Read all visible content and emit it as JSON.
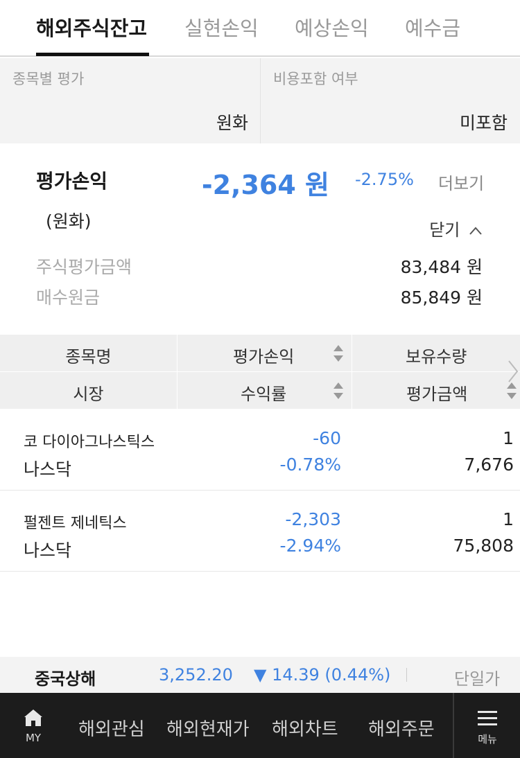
{
  "tabs": [
    {
      "label": "해외주식잔고",
      "active": true
    },
    {
      "label": "실현손익",
      "active": false
    },
    {
      "label": "예상손익",
      "active": false
    },
    {
      "label": "예수금",
      "active": false
    }
  ],
  "filters": {
    "by_stock_label": "종목별 평가",
    "by_stock_value": "원화",
    "include_fee_label": "비용포함 여부",
    "include_fee_value": "미포함"
  },
  "summary": {
    "title": "평가손익",
    "currency_note": "(원화)",
    "amount": "-2,364 원",
    "rate": "-2.75%",
    "more": "더보기",
    "close": "닫기",
    "rows": [
      {
        "label": "주식평가금액",
        "value": "83,484 원"
      },
      {
        "label": "매수원금",
        "value": "85,849 원"
      }
    ]
  },
  "table": {
    "headers": {
      "name": "종목명",
      "market": "시장",
      "pl": "평가손익",
      "rate": "수익률",
      "qty": "보유수량",
      "eval": "평가금액"
    },
    "rows": [
      {
        "name": "코 다이아그나스틱스",
        "market": "나스닥",
        "pl": "-60",
        "rate": "-0.78%",
        "qty": "1",
        "eval": "7,676"
      },
      {
        "name": "펄젠트 제네틱스",
        "market": "나스닥",
        "pl": "-2,303",
        "rate": "-2.94%",
        "qty": "1",
        "eval": "75,808"
      }
    ]
  },
  "ticker": {
    "name": "중국상해",
    "value": "3,252.20",
    "change": "▼ 14.39 (0.44%)",
    "button": "단일가"
  },
  "bottom_nav": {
    "my_label": "MY",
    "items": [
      "해외관심",
      "해외현재가",
      "해외차트",
      "해외주문"
    ],
    "menu_label": "메뉴"
  },
  "colors": {
    "accent_blue": "#3f82e0",
    "nav_bg": "#1c1c1c"
  },
  "icons": [
    "home-icon",
    "chevron-up-icon",
    "sort-icon",
    "chevron-right-icon",
    "hamburger-menu-icon"
  ]
}
